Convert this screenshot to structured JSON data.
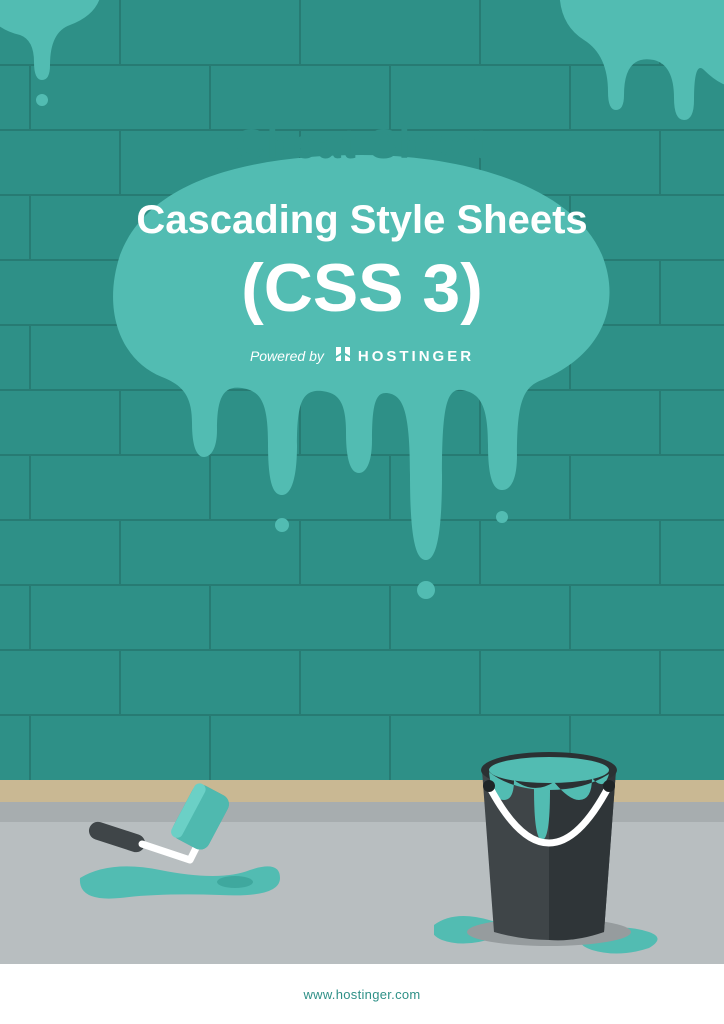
{
  "cover": {
    "pretitle": "Cheat Sheet",
    "subtitle": "Cascading Style Sheets",
    "title": "(CSS 3)",
    "powered_label": "Powered by",
    "brand": "HOSTINGER"
  },
  "footer": {
    "url": "www.hostinger.com"
  },
  "colors": {
    "wall": "#2e9087",
    "paint": "#52bcb2",
    "bucket": "#3f4548",
    "floor": "#b8bec0",
    "baseboard": "#c9b893"
  }
}
